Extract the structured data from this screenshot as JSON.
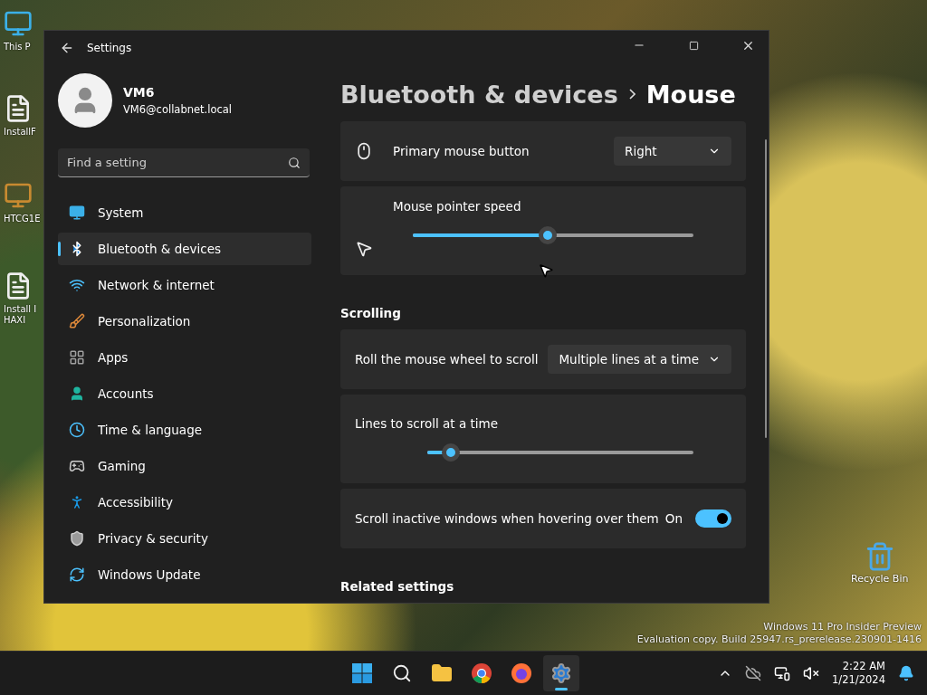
{
  "desktop": {
    "icons": [
      {
        "label": "This P"
      },
      {
        "label": "InstallF"
      },
      {
        "label": "HTCG1E"
      },
      {
        "label": "Install I HAXI"
      }
    ],
    "recycle_bin": {
      "label": "Recycle Bin"
    },
    "watermark": [
      "Windows 11 Pro Insider Preview",
      "Evaluation copy. Build 25947.rs_prerelease.230901-1416"
    ]
  },
  "window": {
    "title": "Settings"
  },
  "profile": {
    "name": "VM6",
    "email": "VM6@collabnet.local"
  },
  "search": {
    "placeholder": "Find a setting"
  },
  "nav": [
    {
      "label": "System",
      "selected": false
    },
    {
      "label": "Bluetooth & devices",
      "selected": true
    },
    {
      "label": "Network & internet",
      "selected": false
    },
    {
      "label": "Personalization",
      "selected": false
    },
    {
      "label": "Apps",
      "selected": false
    },
    {
      "label": "Accounts",
      "selected": false
    },
    {
      "label": "Time & language",
      "selected": false
    },
    {
      "label": "Gaming",
      "selected": false
    },
    {
      "label": "Accessibility",
      "selected": false
    },
    {
      "label": "Privacy & security",
      "selected": false
    },
    {
      "label": "Windows Update",
      "selected": false
    }
  ],
  "breadcrumb": {
    "parent": "Bluetooth & devices",
    "current": "Mouse"
  },
  "settings": [
    {
      "kind": "dropdown",
      "label": "Primary mouse button",
      "value": "Right"
    },
    {
      "kind": "slider",
      "label": "Mouse pointer speed",
      "level": 0.48
    },
    {
      "kind": "section",
      "title": "Scrolling"
    },
    {
      "kind": "dropdown",
      "label": "Roll the mouse wheel to scroll",
      "value": "Multiple lines at a time"
    },
    {
      "kind": "slider",
      "label": "Lines to scroll at a time",
      "level": 0.09
    },
    {
      "kind": "toggle",
      "label": "Scroll inactive windows when hovering over them",
      "state_label": "On",
      "on": true
    },
    {
      "kind": "section",
      "title": "Related settings"
    }
  ],
  "taskbar": {
    "apps": [
      {
        "selected": false
      },
      {
        "selected": false
      },
      {
        "selected": false
      },
      {
        "selected": false
      },
      {
        "selected": false
      },
      {
        "selected": true
      }
    ]
  },
  "tray": {
    "time": "2:22 AM",
    "date": "1/21/2024"
  }
}
